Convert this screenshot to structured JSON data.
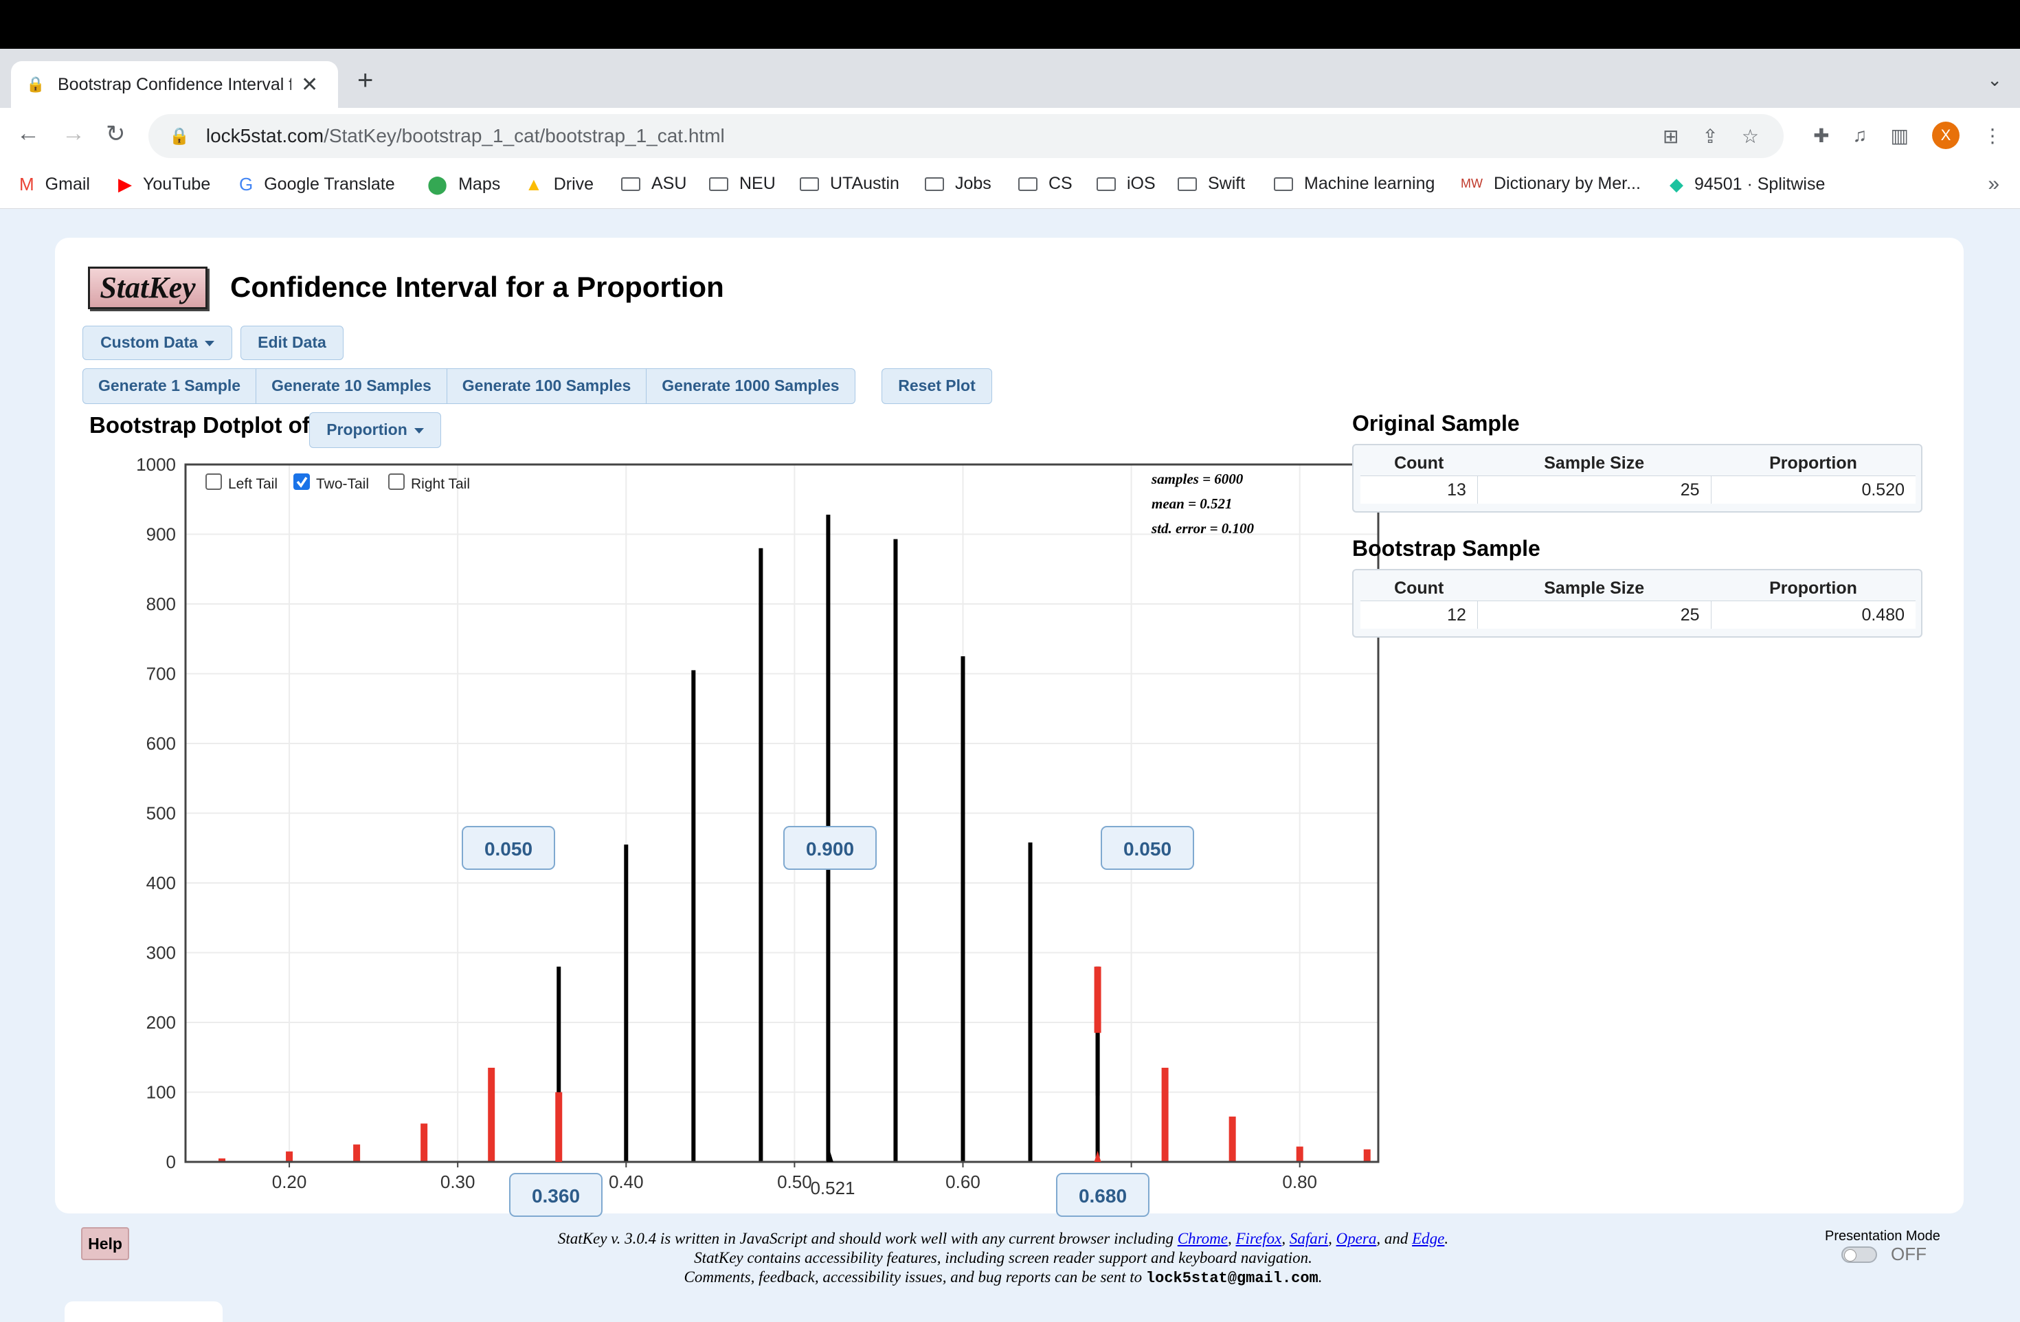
{
  "browser": {
    "tab_title": "Bootstrap Confidence Interval f",
    "url_host": "lock5stat.com",
    "url_path": "/StatKey/bootstrap_1_cat/bootstrap_1_cat.html",
    "profile_initial": "X",
    "bookmarks": [
      "Gmail",
      "YouTube",
      "Google Translate",
      "Maps",
      "Drive",
      "ASU",
      "NEU",
      "UTAustin",
      "Jobs",
      "CS",
      "iOS",
      "Swift",
      "Machine learning",
      "Dictionary by Mer...",
      "94501 · Splitwise"
    ]
  },
  "page": {
    "logo": "StatKey",
    "title": "Confidence Interval for a Proportion",
    "custom_data_label": "Custom Data",
    "edit_data_label": "Edit Data",
    "generate_buttons": [
      "Generate 1 Sample",
      "Generate 10 Samples",
      "Generate 100 Samples",
      "Generate 1000 Samples"
    ],
    "reset_label": "Reset Plot",
    "dotplot_label": "Bootstrap Dotplot of",
    "dotplot_select": "Proportion"
  },
  "chart_controls": {
    "left_tail": {
      "label": "Left Tail",
      "checked": false
    },
    "two_tail": {
      "label": "Two-Tail",
      "checked": true
    },
    "right_tail": {
      "label": "Right Tail",
      "checked": false
    },
    "stats_lines": [
      "samples = 6000",
      "mean = 0.521",
      "std. error = 0.100"
    ],
    "tail_boxes": [
      "0.050",
      "0.900",
      "0.050"
    ],
    "bound_left": "0.360",
    "bound_right": "0.680",
    "mean_label": "0.521"
  },
  "chart_data": {
    "type": "bar",
    "xlim": [
      0.14,
      0.845
    ],
    "ylim": [
      0,
      1000
    ],
    "xticks": [
      0.2,
      0.3,
      0.4,
      0.5,
      0.6,
      0.7,
      0.8
    ],
    "xtick_labels": [
      "0.20",
      "0.30",
      "0.40",
      "0.50",
      "0.60",
      "0.70",
      "0.80"
    ],
    "yticks": [
      0,
      100,
      200,
      300,
      400,
      500,
      600,
      700,
      800,
      900,
      1000
    ],
    "ytick_labels": [
      "0",
      "100",
      "200",
      "300",
      "400",
      "500",
      "600",
      "700",
      "800",
      "900",
      "1000"
    ],
    "grid": true,
    "in_tail_color": "#e8342a",
    "center_color": "#000000",
    "bars": [
      {
        "x": 0.16,
        "count": 5,
        "red": 5
      },
      {
        "x": 0.2,
        "count": 15,
        "red": 15
      },
      {
        "x": 0.24,
        "count": 25,
        "red": 25
      },
      {
        "x": 0.28,
        "count": 55,
        "red": 55
      },
      {
        "x": 0.32,
        "count": 135,
        "red": 135
      },
      {
        "x": 0.36,
        "count": 280,
        "red": 100
      },
      {
        "x": 0.4,
        "count": 455,
        "red": 0
      },
      {
        "x": 0.44,
        "count": 705,
        "red": 0
      },
      {
        "x": 0.48,
        "count": 880,
        "red": 0
      },
      {
        "x": 0.52,
        "count": 928,
        "red": 0
      },
      {
        "x": 0.56,
        "count": 893,
        "red": 0
      },
      {
        "x": 0.6,
        "count": 725,
        "red": 0
      },
      {
        "x": 0.64,
        "count": 458,
        "red": 0
      },
      {
        "x": 0.68,
        "count": 280,
        "red": 95
      },
      {
        "x": 0.72,
        "count": 135,
        "red": 135
      },
      {
        "x": 0.76,
        "count": 65,
        "red": 65
      },
      {
        "x": 0.8,
        "count": 22,
        "red": 22
      },
      {
        "x": 0.84,
        "count": 18,
        "red": 18
      }
    ],
    "cutoffs": [
      0.36,
      0.68
    ],
    "mean": 0.521
  },
  "original_sample": {
    "title": "Original Sample",
    "headers": [
      "Count",
      "Sample Size",
      "Proportion"
    ],
    "values": [
      "13",
      "25",
      "0.520"
    ]
  },
  "bootstrap_sample": {
    "title": "Bootstrap Sample",
    "headers": [
      "Count",
      "Sample Size",
      "Proportion"
    ],
    "values": [
      "12",
      "25",
      "0.480"
    ]
  },
  "footer": {
    "help_label": "Help",
    "line1_start": "StatKey v. 3.0.4 is written in JavaScript and should work well with any current browser including ",
    "browsers": [
      "Chrome",
      "Firefox",
      "Safari",
      "Opera",
      "Edge"
    ],
    "line2": "StatKey contains accessibility features, including screen reader support and keyboard navigation.",
    "line3_start": "Comments, feedback, accessibility issues, and bug reports can be sent to ",
    "email": "lock5stat@gmail.com",
    "presentation_mode_label": "Presentation Mode",
    "presentation_state": "OFF"
  }
}
